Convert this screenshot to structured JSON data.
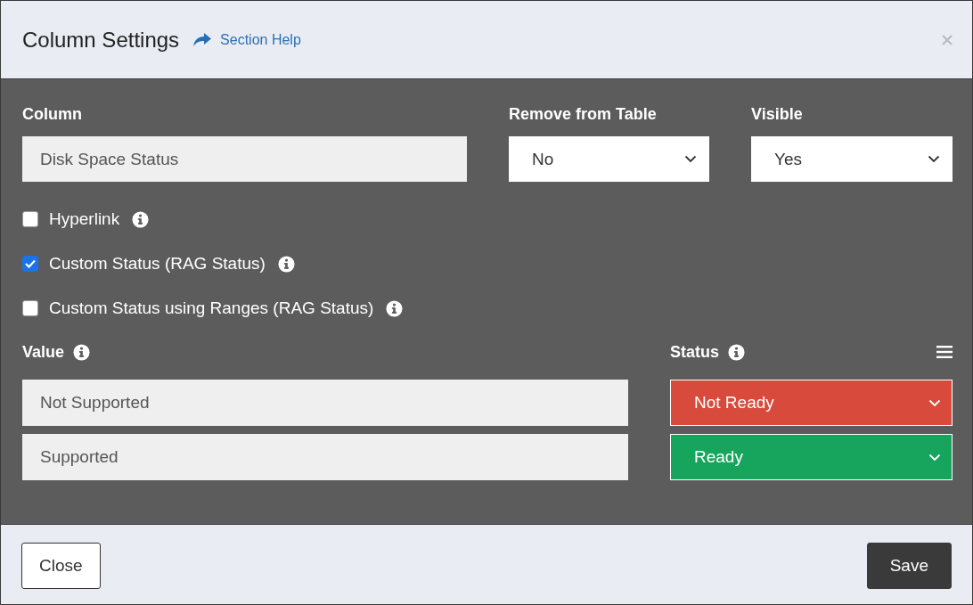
{
  "dialog": {
    "title": "Column Settings",
    "help_link": "Section Help"
  },
  "fields": [
    {
      "label": "Column",
      "kind": "text",
      "value": "Disk Space Status"
    },
    {
      "label": "Remove from Table",
      "kind": "select",
      "value": "No"
    },
    {
      "label": "Visible",
      "kind": "select",
      "value": "Yes"
    }
  ],
  "options": [
    {
      "label": "Hyperlink",
      "checked": false
    },
    {
      "label": "Custom Status (RAG Status)",
      "checked": true
    },
    {
      "label": "Custom Status using Ranges (RAG Status)",
      "checked": false
    }
  ],
  "rules": {
    "value_label": "Value",
    "status_label": "Status",
    "rows": [
      {
        "value": "Not Supported",
        "status": "Not Ready",
        "color": "#d84b3c"
      },
      {
        "value": "Supported",
        "status": "Ready",
        "color": "#17a55d"
      }
    ]
  },
  "buttons": [
    {
      "label": "Close",
      "kind": "secondary"
    },
    {
      "label": "Save",
      "kind": "primary"
    }
  ]
}
